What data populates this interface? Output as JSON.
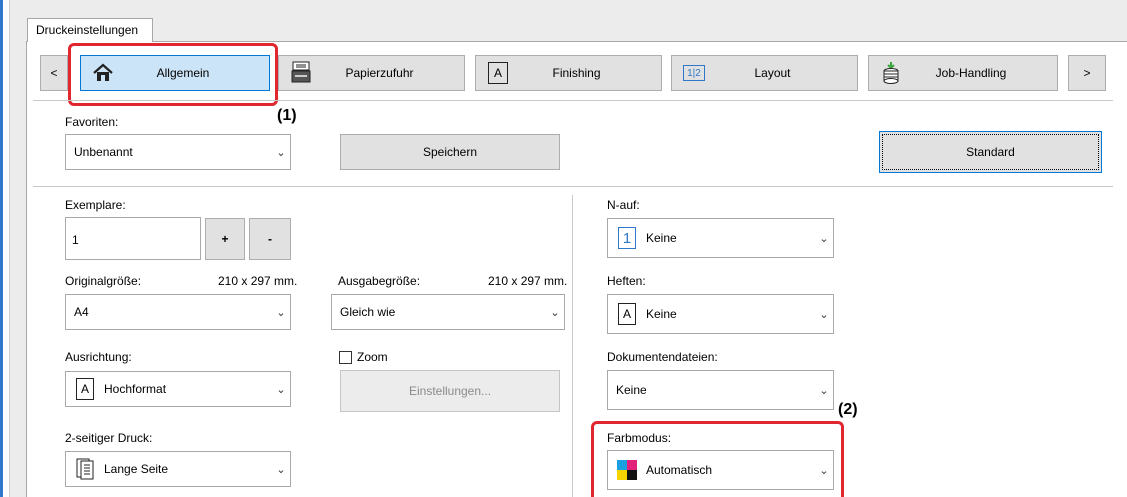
{
  "window": {
    "tab_title": "Druckeinstellungen"
  },
  "nav": {
    "prev_label": "<",
    "next_label": ">",
    "tabs": [
      {
        "label": "Allgemein",
        "icon": "home-icon",
        "active": true
      },
      {
        "label": "Papierzufuhr",
        "icon": "paper-tray-icon",
        "active": false
      },
      {
        "label": "Finishing",
        "icon": "finishing-icon",
        "icon_text": "A",
        "active": false
      },
      {
        "label": "Layout",
        "icon": "layout-icon",
        "icon_text": "1|2",
        "active": false
      },
      {
        "label": "Job-Handling",
        "icon": "job-handling-icon",
        "active": false
      }
    ]
  },
  "favorites": {
    "label": "Favoriten:",
    "value": "Unbenannt",
    "save_label": "Speichern",
    "default_label": "Standard"
  },
  "copies": {
    "label": "Exemplare:",
    "value": "1",
    "plus_label": "+",
    "minus_label": "-"
  },
  "original_size": {
    "label": "Originalgröße:",
    "dims": "210 x 297 mm.",
    "value": "A4"
  },
  "output_size": {
    "label": "Ausgabegröße:",
    "dims": "210 x 297 mm.",
    "value": "Gleich wie"
  },
  "orientation": {
    "label": "Ausrichtung:",
    "value": "Hochformat",
    "icon_text": "A"
  },
  "zoom": {
    "label": "Zoom",
    "checked": false,
    "settings_label": "Einstellungen..."
  },
  "duplex": {
    "label": "2-seitiger Druck:",
    "value": "Lange Seite"
  },
  "n_up": {
    "label": "N-auf:",
    "value": "Keine",
    "icon_text": "1"
  },
  "staple": {
    "label": "Heften:",
    "value": "Keine",
    "icon_text": "A"
  },
  "document_filing": {
    "label": "Dokumentendateien:",
    "value": "Keine"
  },
  "color_mode": {
    "label": "Farbmodus:",
    "value": "Automatisch"
  },
  "callouts": {
    "one": "(1)",
    "two": "(2)"
  },
  "colors": {
    "highlight": "#e0262e",
    "accent": "#2f77c9",
    "active_tab": "#cce4f7"
  }
}
